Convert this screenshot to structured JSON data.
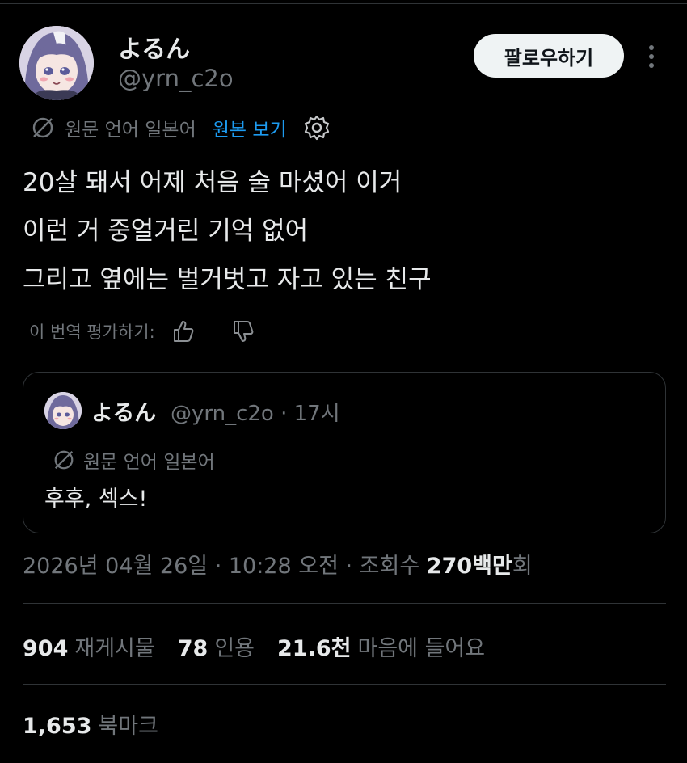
{
  "author": {
    "display_name": "よるん",
    "handle": "@yrn_c2o",
    "avatar_icon": "anime-avatar-icon"
  },
  "header": {
    "follow_label": "팔로우하기",
    "more_icon": "more-vertical-icon"
  },
  "translation": {
    "label": "원문 언어 일본어",
    "view_original": "원본 보기",
    "settings_icon": "gear-icon",
    "translate_icon": "translate-icon"
  },
  "tweet": {
    "lines": [
      "20살 돼서 어제 처음 술 마셨어 이거",
      "이런 거 중얼거린 기억 없어",
      "그리고 옆에는 벌거벗고 자고 있는 친구"
    ]
  },
  "rate": {
    "label": "이 번역 평가하기:",
    "up_icon": "thumbs-up-icon",
    "down_icon": "thumbs-down-icon"
  },
  "quote": {
    "display_name": "よるん",
    "handle_time": "@yrn_c2o · 17시",
    "translation_label": "원문 언어 일본어",
    "text": "후후, 섹스!"
  },
  "meta": {
    "datetime": "2026년 04월 26일 · 10:28 오전 · 조회수 ",
    "views": "270백만",
    "views_suffix": "회"
  },
  "stats": {
    "retweets_count": "904",
    "retweets_label": "재게시물",
    "quotes_count": "78",
    "quotes_label": "인용",
    "likes_count": "21.6천",
    "likes_label": "마음에 들어요",
    "bookmarks_count": "1,653",
    "bookmarks_label": "북마크"
  },
  "colors": {
    "background": "#000000",
    "text": "#e7e9ea",
    "muted": "#71767b",
    "link": "#1d9bf0",
    "border": "#2f3336"
  }
}
